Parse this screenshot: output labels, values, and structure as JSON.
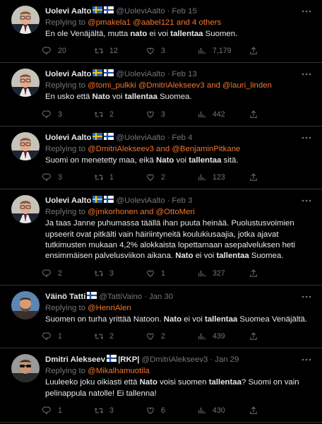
{
  "tweets": [
    {
      "name": "Uolevi Aalto",
      "flags": [
        "se",
        "fi"
      ],
      "handle": "@UoleviAalto",
      "date": "Feb 15",
      "reply_prefix": "Replying to ",
      "reply_to": "@pmakela1 @aabel121 and 4 others",
      "text_parts": [
        "En ole Venäjältä, mutta ",
        "nato",
        " ei voi ",
        "tallentaa",
        " Suomen."
      ],
      "replies": "20",
      "retweets": "12",
      "likes": "3",
      "views": "7,179",
      "avatar": "man-glasses"
    },
    {
      "name": "Uolevi Aalto",
      "flags": [
        "se",
        "fi"
      ],
      "handle": "@UoleviAalto",
      "date": "Feb 13",
      "reply_prefix": "Replying to ",
      "reply_to": "@tomi_pulkki @DmitriAlekseev3 and @lauri_linden",
      "text_parts": [
        "En usko että ",
        "Nato",
        " voi ",
        "tallentaa",
        " Suomea."
      ],
      "replies": "3",
      "retweets": "2",
      "likes": "3",
      "views": "442",
      "avatar": "man-glasses"
    },
    {
      "name": "Uolevi Aalto",
      "flags": [
        "se",
        "fi"
      ],
      "handle": "@UoleviAalto",
      "date": "Feb 4",
      "reply_prefix": "Replying to ",
      "reply_to": "@DmitriAlekseev3 and @BenjaminPitkane",
      "text_parts": [
        "Suomi on menetetty maa, eikä ",
        "Nato",
        " voi ",
        "tallentaa",
        " sitä."
      ],
      "replies": "3",
      "retweets": "1",
      "likes": "2",
      "views": "123",
      "avatar": "man-glasses"
    },
    {
      "name": "Uolevi Aalto",
      "flags": [
        "se",
        "fi"
      ],
      "handle": "@UoleviAalto",
      "date": "Feb 3",
      "reply_prefix": "Replying to ",
      "reply_to": "@jmkorhonen and @OttoMeri",
      "text_parts": [
        "Ja taas Janne puhumassa täällä ihan puuta heinää. Puolustusvoimien upseerit ovat pitkälti vain häiriintyneitä koulukiusaajia, jotka ajavat tutkimusten mukaan 4,2% alokkaista lopettamaan asepalveluksen heti ensimmäisen palvelusviikon aikana. ",
        "Nato",
        " ei voi ",
        "tallentaa",
        " Suomea."
      ],
      "replies": "2",
      "retweets": "3",
      "likes": "1",
      "views": "327",
      "avatar": "man-glasses"
    },
    {
      "name": "Väinö Tatti",
      "flags": [
        "fi"
      ],
      "handle": "@TattiVaino",
      "date": "Jan 30",
      "reply_prefix": "Replying to ",
      "reply_to": "@HenriAlen",
      "text_parts": [
        "Suomen on turha yrittää Natoon. ",
        "Nato",
        " ei voi ",
        "tallentaa",
        " Suomea Venäjältä."
      ],
      "replies": "1",
      "retweets": "2",
      "likes": "2",
      "views": "439",
      "avatar": "man-beard"
    },
    {
      "name": "Dmitri Alekseev",
      "flags": [
        "fi"
      ],
      "name_suffix": "|RKP|",
      "handle": "@DmitriAlekseev3",
      "date": "Jan 29",
      "reply_prefix": "Replying to ",
      "reply_to": "@Mikalhamuotila",
      "text_parts": [
        "Luuleeko joku oikiasti että ",
        "Nato",
        " voisi suomen ",
        "tallentaa",
        "? Suomi on vain pelinappula natolle! Ei tallenna!"
      ],
      "replies": "1",
      "retweets": "3",
      "likes": "6",
      "views": "430",
      "avatar": "man-sunglasses"
    }
  ],
  "colors": {
    "accent": "#f4762c",
    "muted": "#71767b",
    "border": "#2f3336",
    "text": "#e7e9ea"
  }
}
